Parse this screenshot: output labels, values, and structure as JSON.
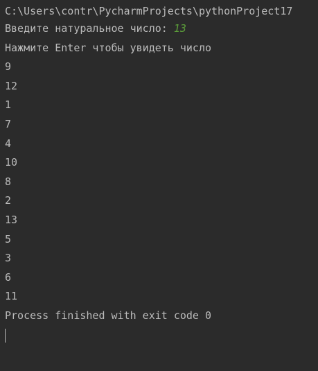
{
  "command_line": "C:\\Users\\contr\\PycharmProjects\\pythonProject17",
  "prompt": {
    "label": "Введите натуральное число: ",
    "input_value": "13"
  },
  "enter_prompt": "Нажмите Enter чтобы увидеть число",
  "numbers": [
    "9",
    "12",
    "1",
    "7",
    "4",
    "10",
    "8",
    "2",
    "13",
    "5",
    "3",
    "6",
    "11"
  ],
  "exit_message": "Process finished with exit code 0",
  "colors": {
    "background": "#2b2b2b",
    "text": "#bbbbbb",
    "input": "#5c9e3a"
  }
}
